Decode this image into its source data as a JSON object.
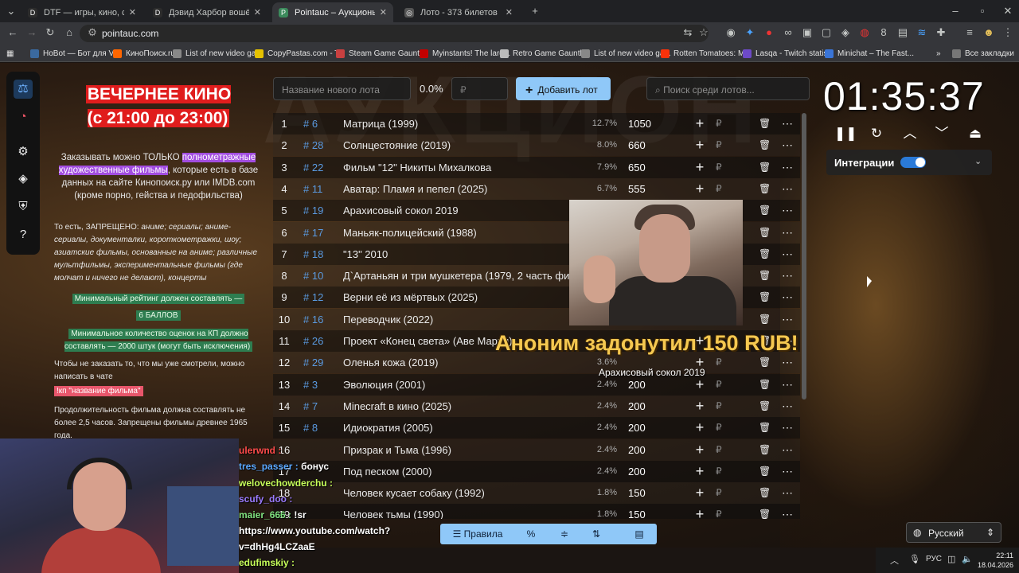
{
  "browser": {
    "tabs": [
      {
        "title": "DTF — игры, кино, сериалы, р",
        "fav": "D",
        "color": "#2c2c2c",
        "active": false
      },
      {
        "title": "Дэвид Харбор вошёл в актёрс",
        "fav": "D",
        "color": "#2c2c2c",
        "active": false
      },
      {
        "title": "Pointauc – Аукционы, лотерея",
        "fav": "P",
        "color": "#3c8a5c",
        "active": true
      },
      {
        "title": "Лото - 373 билетов",
        "fav": "◎",
        "color": "#555",
        "active": false
      }
    ],
    "url": "pointauc.com",
    "bookmarks": [
      {
        "label": "HoBot — Бот для V...",
        "color": "#3b6aa0"
      },
      {
        "label": "КиноПоиск.ru",
        "color": "#ff6600"
      },
      {
        "label": "List of new video ga...",
        "color": "#888"
      },
      {
        "label": "CopyPastas.com - T...",
        "color": "#e5c100"
      },
      {
        "label": "Steam Game Gauntlet",
        "color": "#c94040"
      },
      {
        "label": "Myinstants! The larg...",
        "color": "#c40000"
      },
      {
        "label": "Retro Game Gauntlet",
        "color": "#bbb"
      },
      {
        "label": "List of new video ga...",
        "color": "#888"
      },
      {
        "label": "Rotten Tomatoes: M...",
        "color": "#fa320a"
      },
      {
        "label": "Lasqa - Twitch statis...",
        "color": "#6d4ac7"
      },
      {
        "label": "Minichat – The Fast...",
        "color": "#3a75d8"
      }
    ],
    "all_bookmarks": "Все закладки"
  },
  "rules": {
    "title": "ВЕЧЕРНЕЕ КИНО (с 21:00 до 23:00)",
    "p1_a": "Заказывать можно ТОЛЬКО ",
    "p1_hl": "полнометражные художественные фильмы",
    "p1_b": ", которые есть в базе данных на сайте Кинопоиск.ру или IMDB.com (кроме порно, гейства и педофильства)",
    "p2_a": "То есть, ЗАПРЕЩЕНО: ",
    "p2_b": "аниме; сериалы; аниме-сериалы, документалки, короткометражки, шоу; азиатские фильмы, основанные на аниме; различные мультфильмы, экспериментальные фильмы (где молчат и ничего не делают), концерты",
    "p3_a": "Минимальный рейтинг должен составлять —",
    "p3_b": "6 БАЛЛОВ",
    "p4": "Минимальное количество оценок на КП должно составлять — 2000 штук (могут быть исключения)",
    "p5": "Чтобы не заказать то, что мы уже смотрели, можно написать в чате",
    "p5_cmd": "!кп \"название фильма\"",
    "p6": "Продолжительность фильма должна составлять не более 2,5 часов. Запрещены фильмы древнее 1965 года."
  },
  "controls": {
    "lot_placeholder": "Название нового лота",
    "percent": "0.0%",
    "rub_placeholder": "₽",
    "add_label": "Добавить лот",
    "search_placeholder": "Поиск среди лотов..."
  },
  "lots": [
    {
      "n": "1",
      "id": "# 6",
      "name": "Матрица (1999)",
      "pct": "12.7%",
      "amount": "1050"
    },
    {
      "n": "2",
      "id": "# 28",
      "name": "Солнцестояние (2019)",
      "pct": "8.0%",
      "amount": "660"
    },
    {
      "n": "3",
      "id": "# 22",
      "name": "Фильм \"12\" Никиты  Михалкова",
      "pct": "7.9%",
      "amount": "650"
    },
    {
      "n": "4",
      "id": "# 11",
      "name": "Аватар: Пламя и пепел (2025)",
      "pct": "6.7%",
      "amount": "555"
    },
    {
      "n": "5",
      "id": "# 19",
      "name": "Арахисовый сокол 2019",
      "pct": "",
      "amount": ""
    },
    {
      "n": "6",
      "id": "# 17",
      "name": "Маньяк-полицейский (1988)",
      "pct": "",
      "amount": ""
    },
    {
      "n": "7",
      "id": "# 18",
      "name": "\"13\" 2010",
      "pct": "",
      "amount": ""
    },
    {
      "n": "8",
      "id": "# 10",
      "name": "Д`Артаньян и три мушкетера (1979, 2 часть фильма)",
      "pct": "",
      "amount": ""
    },
    {
      "n": "9",
      "id": "# 12",
      "name": "Верни её из мёртвых (2025)",
      "pct": "",
      "amount": ""
    },
    {
      "n": "10",
      "id": "# 16",
      "name": "Переводчик (2022)",
      "pct": "",
      "amount": ""
    },
    {
      "n": "11",
      "id": "# 26",
      "name": "Проект «Конец света» (Аве Мария)",
      "pct": "",
      "amount": ""
    },
    {
      "n": "12",
      "id": "# 29",
      "name": "Оленья кожа (2019)",
      "pct": "3.6%",
      "amount": ""
    },
    {
      "n": "13",
      "id": "# 3",
      "name": "Эволюция (2001)",
      "pct": "2.4%",
      "amount": "200"
    },
    {
      "n": "14",
      "id": "# 7",
      "name": "Minecraft в кино (2025)",
      "pct": "2.4%",
      "amount": "200"
    },
    {
      "n": "15",
      "id": "# 8",
      "name": "Идиократия (2005)",
      "pct": "2.4%",
      "amount": "200"
    },
    {
      "n": "16",
      "id": "",
      "name": "Призрак и Тьма (1996)",
      "pct": "2.4%",
      "amount": "200"
    },
    {
      "n": "17",
      "id": "",
      "name": "Под песком (2000)",
      "pct": "2.4%",
      "amount": "200"
    },
    {
      "n": "18",
      "id": "",
      "name": "Человек кусает собаку (1992)",
      "pct": "1.8%",
      "amount": "150"
    },
    {
      "n": "19",
      "id": "",
      "name": "Человек тьмы (1990)",
      "pct": "1.8%",
      "amount": "150"
    }
  ],
  "row_icons": {
    "plus": "+",
    "rub": "₽",
    "trash": "🗑",
    "more": "⋯"
  },
  "donation": {
    "text": "Аноним задонутил 150 RUB!",
    "lot": "Арахисовый сокол 2019"
  },
  "timer": {
    "value": "01:35:37"
  },
  "integrations": {
    "label": "Интеграции"
  },
  "bottom": {
    "rules_label": "Правила",
    "language": "Русский"
  },
  "chat": [
    {
      "user": "ulerwnd :",
      "msg": "",
      "cls": "u1"
    },
    {
      "user": "tres_passer :",
      "msg": "бонус",
      "cls": "u2"
    },
    {
      "user": "welovechowderchu :",
      "msg": "",
      "cls": "u3"
    },
    {
      "user": "scufy_doo :",
      "msg": "",
      "cls": "u4"
    },
    {
      "user": "maier_666 :",
      "msg": "!sr",
      "cls": "u5"
    },
    {
      "user": "",
      "msg": "https://www.youtube.com/watch?",
      "cls": ""
    },
    {
      "user": "",
      "msg": "v=dhHg4LCZaaE",
      "cls": ""
    },
    {
      "user": "edufimskiy :",
      "msg": "",
      "cls": "u3"
    }
  ],
  "taskbar": {
    "lang": "РУС",
    "time": "22:11",
    "date": "18.04.2026"
  }
}
